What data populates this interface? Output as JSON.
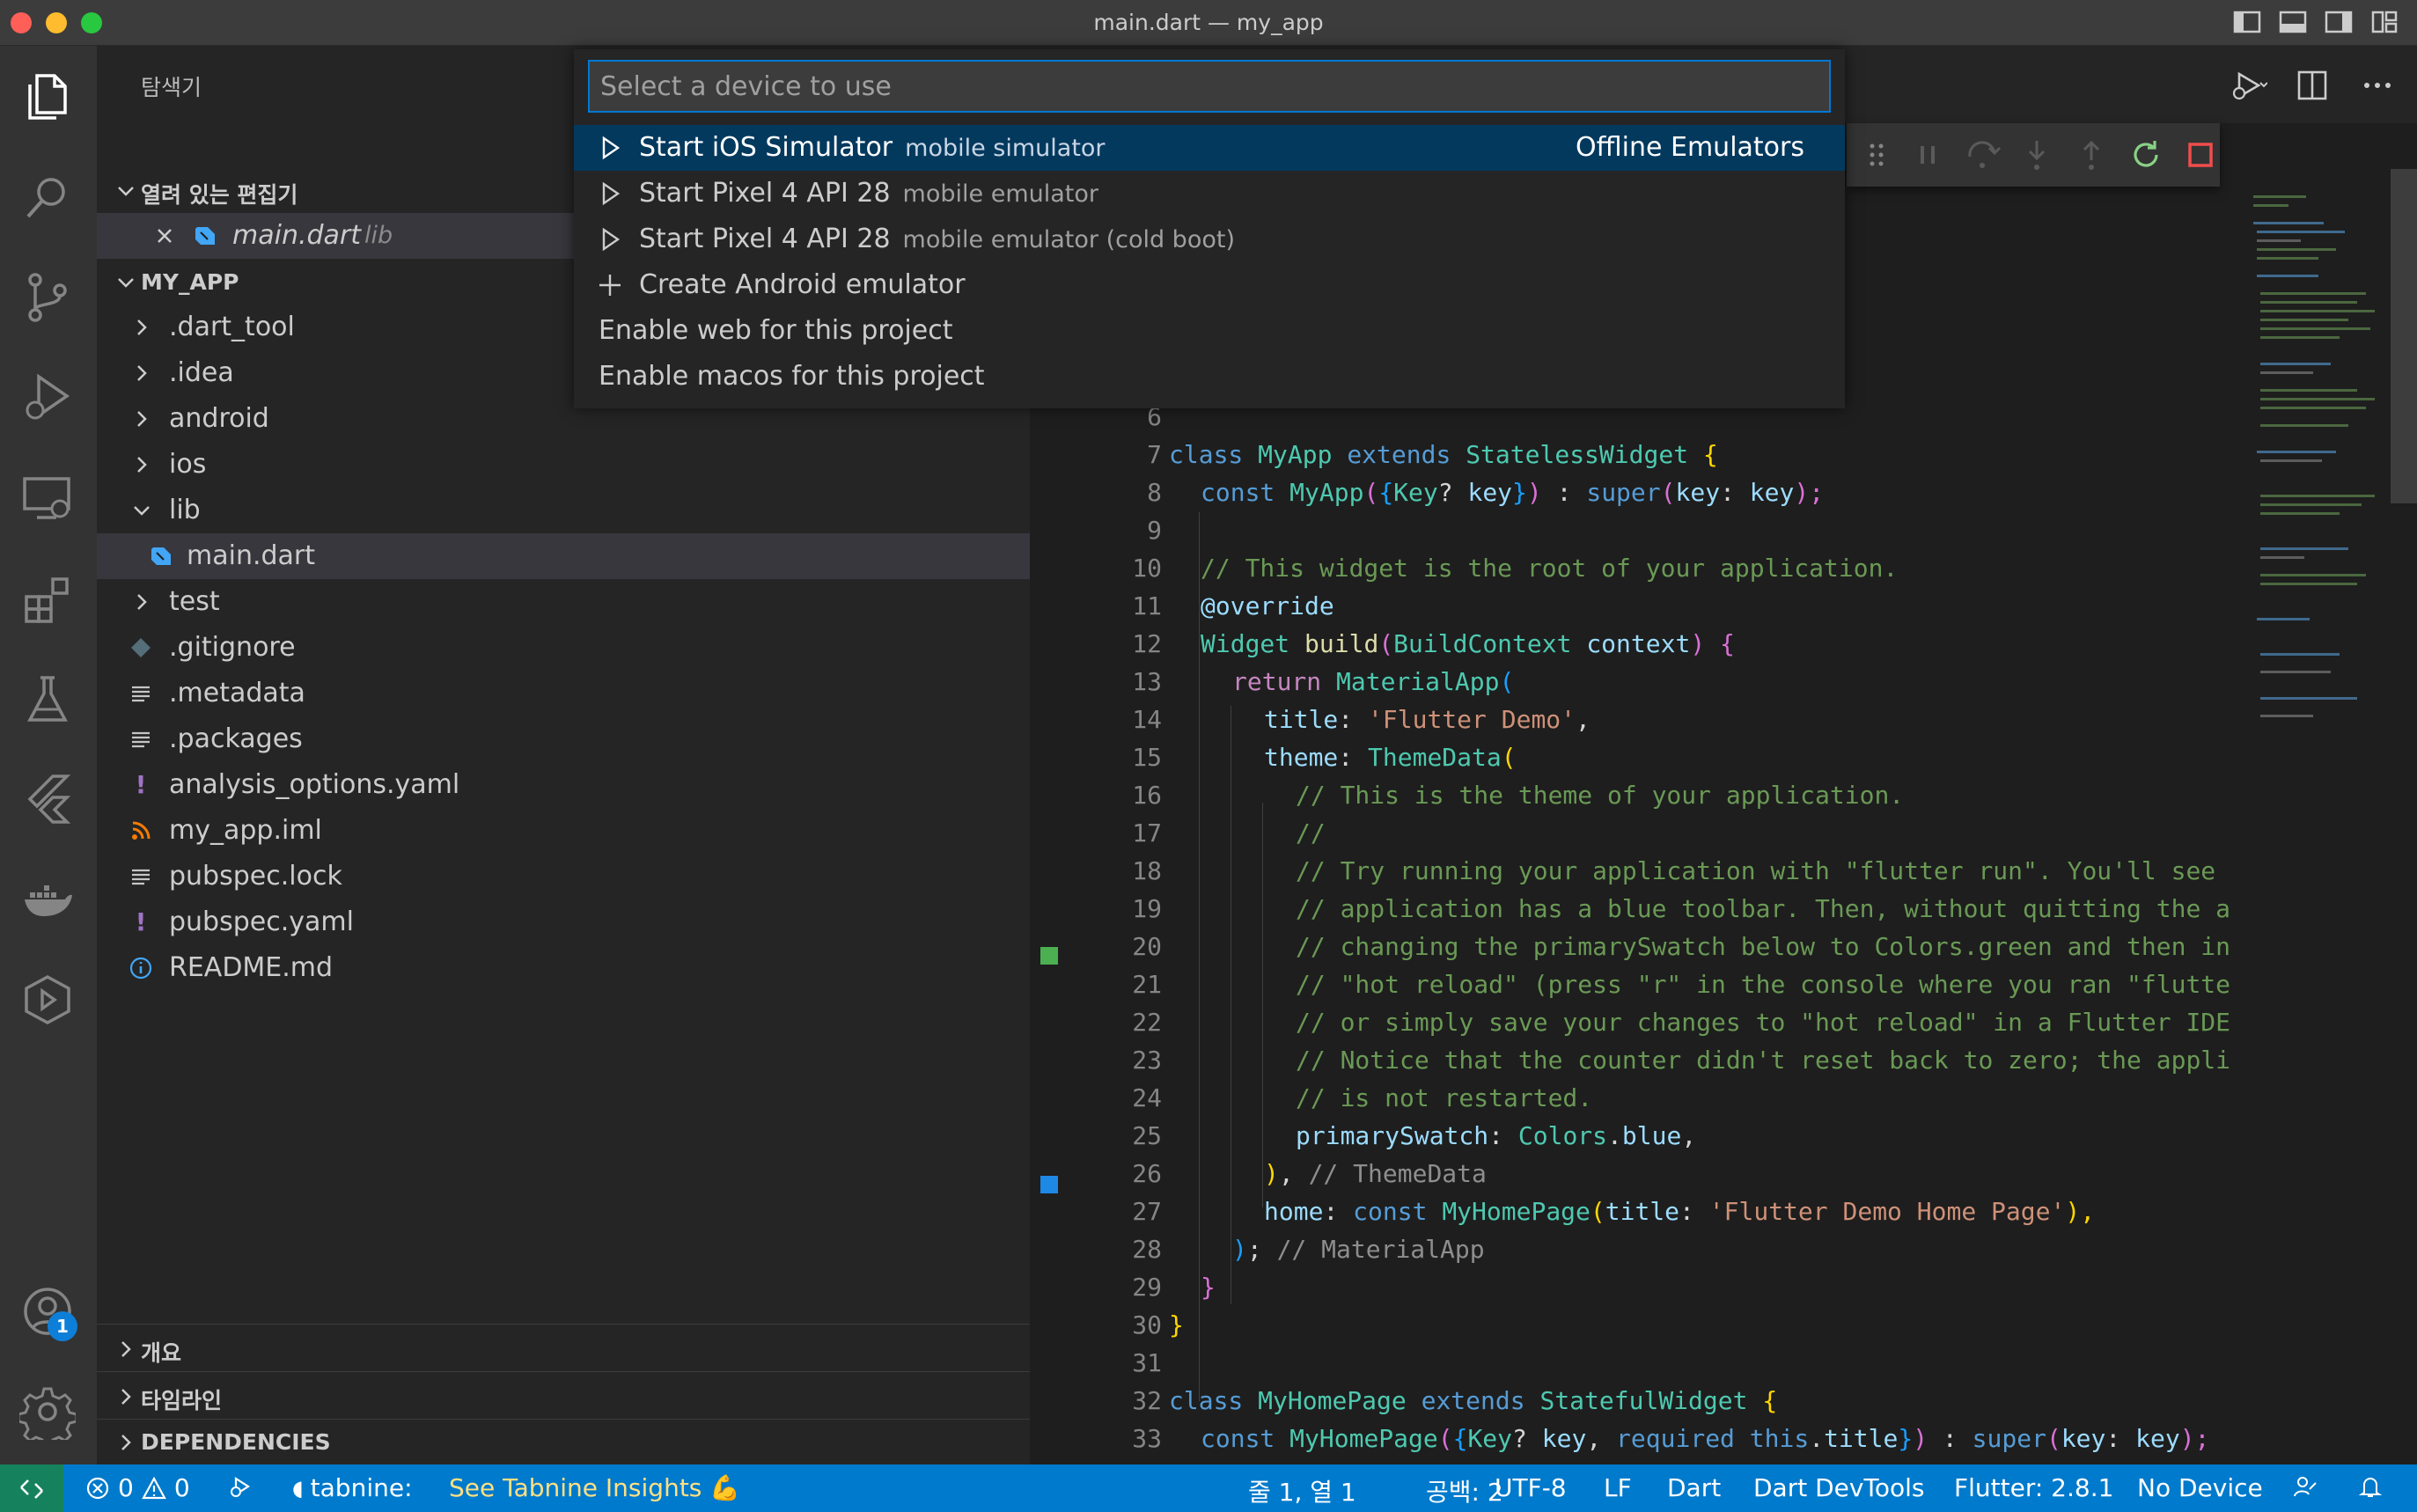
{
  "window": {
    "title": "main.dart — my_app"
  },
  "sidebar": {
    "title": "탐색기",
    "open_editors": {
      "header": "열려 있는 편집기",
      "file": "main.dart",
      "folder": "lib"
    },
    "project": {
      "header": "MY_APP",
      "items": [
        {
          "label": ".dart_tool",
          "kind": "folder",
          "depth": 1
        },
        {
          "label": ".idea",
          "kind": "folder",
          "depth": 1
        },
        {
          "label": "android",
          "kind": "folder",
          "depth": 1
        },
        {
          "label": "ios",
          "kind": "folder",
          "depth": 1
        },
        {
          "label": "lib",
          "kind": "folder-open",
          "depth": 1
        },
        {
          "label": "main.dart",
          "kind": "dart-file",
          "depth": 2
        },
        {
          "label": "test",
          "kind": "folder",
          "depth": 1
        },
        {
          "label": ".gitignore",
          "kind": "git-file",
          "depth": 1
        },
        {
          "label": ".metadata",
          "kind": "text-file",
          "depth": 1
        },
        {
          "label": ".packages",
          "kind": "text-file",
          "depth": 1
        },
        {
          "label": "analysis_options.yaml",
          "kind": "yaml-file",
          "depth": 1
        },
        {
          "label": "my_app.iml",
          "kind": "rss-file",
          "depth": 1
        },
        {
          "label": "pubspec.lock",
          "kind": "text-file",
          "depth": 1
        },
        {
          "label": "pubspec.yaml",
          "kind": "yaml-file",
          "depth": 1
        },
        {
          "label": "README.md",
          "kind": "info-file",
          "depth": 1
        }
      ]
    },
    "bottom_sections": [
      "개요",
      "타임라인",
      "DEPENDENCIES"
    ]
  },
  "quick_pick": {
    "placeholder": "Select a device to use",
    "items": [
      {
        "label": "Start iOS Simulator",
        "description": "mobile simulator",
        "right": "Offline Emulators",
        "icon": "play-icon"
      },
      {
        "label": "Start Pixel 4 API 28",
        "description": "mobile emulator",
        "right": "",
        "icon": "play-icon"
      },
      {
        "label": "Start Pixel 4 API 28",
        "description": "mobile emulator (cold boot)",
        "right": "",
        "icon": "play-icon"
      },
      {
        "label": "Create Android emulator",
        "description": "",
        "right": "",
        "icon": "plus-icon"
      },
      {
        "label": "Enable web for this project",
        "description": "",
        "right": "",
        "icon": ""
      },
      {
        "label": "Enable macos for this project",
        "description": "",
        "right": "",
        "icon": ""
      }
    ]
  },
  "editor": {
    "line_numbers": [
      "6",
      "7",
      "8",
      "9",
      "10",
      "11",
      "12",
      "13",
      "14",
      "15",
      "16",
      "17",
      "18",
      "19",
      "20",
      "21",
      "22",
      "23",
      "24",
      "25",
      "26",
      "27",
      "28",
      "29",
      "30",
      "31",
      "32",
      "33"
    ],
    "code": {
      "l7": {
        "a": "class",
        "b": " ",
        "c": "MyApp",
        "d": " ",
        "e": "extends",
        "f": " ",
        "g": "StatelessWidget",
        "h": " ",
        "i": "{"
      },
      "l8": {
        "a": "const",
        "b": " ",
        "c": "MyApp",
        "d": "(",
        "e": "{",
        "f": "Key",
        "g": "? ",
        "h": "key",
        "i": "}",
        "j": ")",
        "k": " : ",
        "l": "super",
        "m": "(",
        "n": "key",
        "o": ": ",
        "p": "key",
        "q": ");"
      },
      "l10": "// This widget is the root of your application.",
      "l11": "@override",
      "l12": {
        "a": "Widget",
        "b": " ",
        "c": "build",
        "d": "(",
        "e": "BuildContext",
        "f": " ",
        "g": "context",
        "h": ")",
        "i": " {"
      },
      "l13": {
        "a": "return",
        "b": " ",
        "c": "MaterialApp",
        "d": "("
      },
      "l14": {
        "a": "title",
        "b": ": ",
        "c": "'Flutter Demo'",
        "d": ","
      },
      "l15": {
        "a": "theme",
        "b": ": ",
        "c": "ThemeData",
        "d": "("
      },
      "l16": "// This is the theme of your application.",
      "l17": "//",
      "l18": "// Try running your application with \"flutter run\". You'll see",
      "l19": "// application has a blue toolbar. Then, without quitting the a",
      "l20": "// changing the primarySwatch below to Colors.green and then in",
      "l21": "// \"hot reload\" (press \"r\" in the console where you ran \"flutte",
      "l22": "// or simply save your changes to \"hot reload\" in a Flutter IDE",
      "l23": "// Notice that the counter didn't reset back to zero; the appli",
      "l24": "// is not restarted.",
      "l25": {
        "a": "primarySwatch",
        "b": ": ",
        "c": "Colors",
        "d": ".",
        "e": "blue",
        "f": ","
      },
      "l26": {
        "a": ")",
        "b": ", ",
        "c": "// ThemeData"
      },
      "l27": {
        "a": "home",
        "b": ": ",
        "c": "const",
        "d": " ",
        "e": "MyHomePage",
        "f": "(",
        "g": "title",
        "h": ": ",
        "i": "'Flutter Demo Home Page'",
        "j": "),"
      },
      "l28": {
        "a": ")",
        "b": "; ",
        "c": "// MaterialApp"
      },
      "l29": "}",
      "l30": "}",
      "l32": {
        "a": "class",
        "b": " ",
        "c": "MyHomePage",
        "d": " ",
        "e": "extends",
        "f": " ",
        "g": "StatefulWidget",
        "h": " ",
        "i": "{"
      },
      "l33": {
        "a": "const",
        "b": " ",
        "c": "MyHomePage",
        "d": "(",
        "e": "{",
        "f": "Key",
        "g": "? ",
        "h": "key",
        "i": ", ",
        "j": "required",
        "k": " ",
        "l": "this",
        "m": ".",
        "n": "title",
        "o": "}",
        "p": ")",
        "q": " : ",
        "r": "super",
        "s": "(",
        "t": "key",
        "u": ": ",
        "v": "key",
        "w": ");"
      }
    },
    "gutter_marks": [
      {
        "line": "20",
        "color": "#4caf50"
      },
      {
        "line": "25",
        "color": "#1e88e5"
      }
    ]
  },
  "status_bar": {
    "errors": "0",
    "warnings": "0",
    "tabnine": "tabnine:",
    "tabnine_insights": "See Tabnine Insights 💪",
    "position": "줄 1, 열 1",
    "spaces": "공백: 2",
    "encoding": "UTF-8",
    "eol": "LF",
    "language": "Dart",
    "devtools": "Dart DevTools",
    "flutter": "Flutter: 2.8.1",
    "device": "No Device"
  },
  "activity_bar": {
    "accounts_badge": "1",
    "icons": [
      "files-icon",
      "search-icon",
      "source-control-icon",
      "run-debug-icon",
      "remote-explorer-icon",
      "extensions-icon",
      "testing-icon",
      "flutter-icon",
      "docker-icon",
      "devtools-icon",
      "accounts-icon",
      "settings-gear-icon"
    ]
  }
}
